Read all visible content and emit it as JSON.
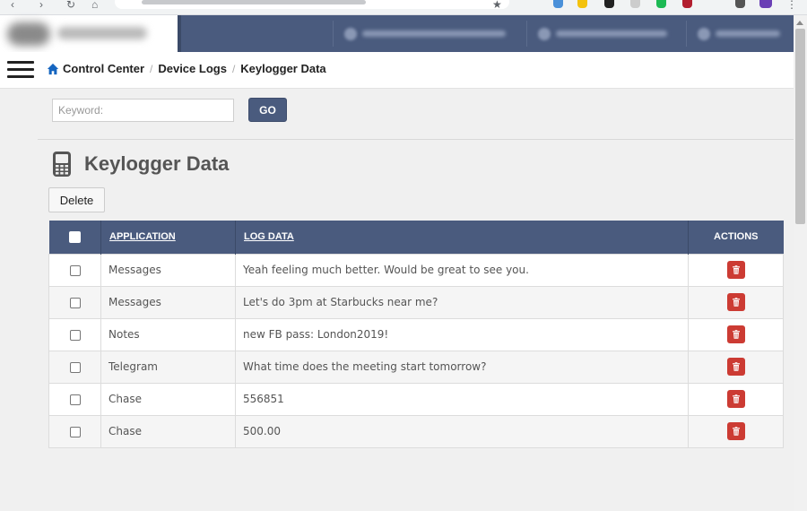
{
  "header": {
    "links": [
      "",
      "",
      ""
    ]
  },
  "breadcrumb": {
    "items": [
      "Control Center",
      "Device Logs",
      "Keylogger Data"
    ]
  },
  "search": {
    "placeholder": "Keyword:",
    "value": "",
    "go_label": "GO"
  },
  "page": {
    "title": "Keylogger Data",
    "delete_label": "Delete"
  },
  "table": {
    "columns": {
      "application": "APPLICATION",
      "log_data": "LOG DATA",
      "actions": "ACTIONS"
    },
    "rows": [
      {
        "application": "Messages",
        "log_data": "Yeah feeling much better. Would be great to see you."
      },
      {
        "application": "Messages",
        "log_data": "Let's do 3pm at Starbucks near me?"
      },
      {
        "application": "Notes",
        "log_data": "new FB pass: London2019!"
      },
      {
        "application": "Telegram",
        "log_data": "What time does the meeting start tomorrow?"
      },
      {
        "application": "Chase",
        "log_data": "556851"
      },
      {
        "application": "Chase",
        "log_data": "500.00"
      }
    ]
  },
  "icons": {
    "home": "home-icon",
    "device": "mobile-phone-icon",
    "delete_row": "trash-icon",
    "menu": "hamburger-menu-icon"
  },
  "colors": {
    "header_bg": "#4a5b7e",
    "delete_action": "#cc3b33",
    "home_icon": "#1565c0",
    "content_bg": "#f0f0f0"
  }
}
